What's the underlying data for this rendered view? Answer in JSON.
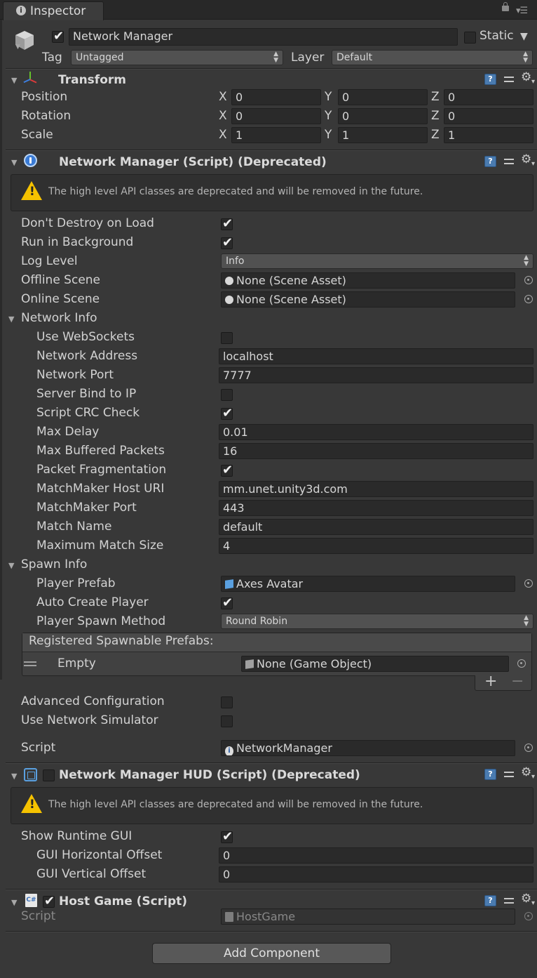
{
  "window": {
    "tab_label": "Inspector"
  },
  "gameobject": {
    "name": "Network Manager",
    "static_label": "Static",
    "tag_label": "Tag",
    "tag_value": "Untagged",
    "layer_label": "Layer",
    "layer_value": "Default"
  },
  "transform": {
    "title": "Transform",
    "rows": [
      {
        "label": "Position",
        "x": "0",
        "y": "0",
        "z": "0"
      },
      {
        "label": "Rotation",
        "x": "0",
        "y": "0",
        "z": "0"
      },
      {
        "label": "Scale",
        "x": "1",
        "y": "1",
        "z": "1"
      }
    ],
    "axis_labels": {
      "x": "X",
      "y": "Y",
      "z": "Z"
    }
  },
  "network_manager": {
    "title": "Network Manager (Script) (Deprecated)",
    "warning": "The high level API classes are deprecated and will be removed in the future.",
    "dont_destroy_label": "Don't Destroy on Load",
    "run_in_bg_label": "Run in Background",
    "log_level_label": "Log Level",
    "log_level_value": "Info",
    "offline_scene_label": "Offline Scene",
    "offline_scene_value": "None (Scene Asset)",
    "online_scene_label": "Online Scene",
    "online_scene_value": "None (Scene Asset)",
    "network_info_label": "Network Info",
    "use_websockets_label": "Use WebSockets",
    "network_address_label": "Network Address",
    "network_address_value": "localhost",
    "network_port_label": "Network Port",
    "network_port_value": "7777",
    "server_bind_label": "Server Bind to IP",
    "script_crc_label": "Script CRC Check",
    "max_delay_label": "Max Delay",
    "max_delay_value": "0.01",
    "max_buffered_label": "Max Buffered Packets",
    "max_buffered_value": "16",
    "packet_frag_label": "Packet Fragmentation",
    "mm_host_label": "MatchMaker Host URI",
    "mm_host_value": "mm.unet.unity3d.com",
    "mm_port_label": "MatchMaker Port",
    "mm_port_value": "443",
    "match_name_label": "Match Name",
    "match_name_value": "default",
    "max_match_label": "Maximum Match Size",
    "max_match_value": "4",
    "spawn_info_label": "Spawn Info",
    "player_prefab_label": "Player Prefab",
    "player_prefab_value": "Axes Avatar",
    "auto_create_label": "Auto Create Player",
    "spawn_method_label": "Player Spawn Method",
    "spawn_method_value": "Round Robin",
    "registered_label": "Registered Spawnable Prefabs:",
    "registered_item_label": "Empty",
    "registered_item_value": "None (Game Object)",
    "plus": "+",
    "minus": "−",
    "advanced_label": "Advanced Configuration",
    "simulator_label": "Use Network Simulator",
    "script_label": "Script",
    "script_value": "NetworkManager"
  },
  "hud": {
    "title": "Network Manager HUD (Script) (Deprecated)",
    "warning": "The high level API classes are deprecated and will be removed in the future.",
    "show_gui_label": "Show Runtime GUI",
    "h_offset_label": "GUI Horizontal Offset",
    "h_offset_value": "0",
    "v_offset_label": "GUI Vertical Offset",
    "v_offset_value": "0"
  },
  "host_game": {
    "title": "Host Game (Script)",
    "script_label": "Script",
    "script_value": "HostGame"
  },
  "add_component_label": "Add Component"
}
